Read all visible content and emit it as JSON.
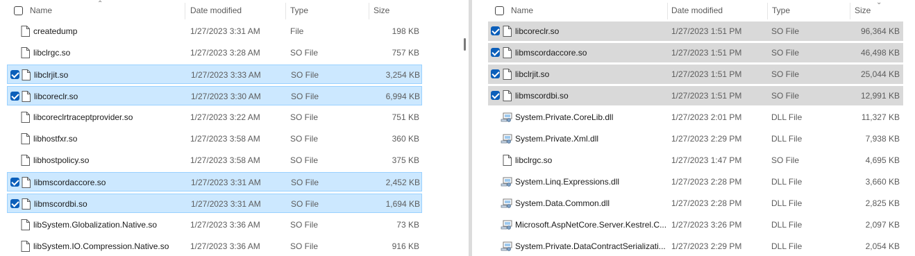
{
  "left": {
    "headers": {
      "name": "Name",
      "date": "Date modified",
      "type": "Type",
      "size": "Size"
    },
    "rows": [
      {
        "name": "createdump",
        "date": "1/27/2023 3:31 AM",
        "type": "File",
        "size": "198 KB",
        "selected": false,
        "icon": "file-icon"
      },
      {
        "name": "libclrgc.so",
        "date": "1/27/2023 3:28 AM",
        "type": "SO File",
        "size": "757 KB",
        "selected": false,
        "icon": "file-icon"
      },
      {
        "name": "libclrjit.so",
        "date": "1/27/2023 3:33 AM",
        "type": "SO File",
        "size": "3,254 KB",
        "selected": true,
        "icon": "file-icon"
      },
      {
        "name": "libcoreclr.so",
        "date": "1/27/2023 3:30 AM",
        "type": "SO File",
        "size": "6,994 KB",
        "selected": true,
        "icon": "file-icon"
      },
      {
        "name": "libcoreclrtraceptprovider.so",
        "date": "1/27/2023 3:22 AM",
        "type": "SO File",
        "size": "751 KB",
        "selected": false,
        "icon": "file-icon"
      },
      {
        "name": "libhostfxr.so",
        "date": "1/27/2023 3:58 AM",
        "type": "SO File",
        "size": "360 KB",
        "selected": false,
        "icon": "file-icon"
      },
      {
        "name": "libhostpolicy.so",
        "date": "1/27/2023 3:58 AM",
        "type": "SO File",
        "size": "375 KB",
        "selected": false,
        "icon": "file-icon"
      },
      {
        "name": "libmscordaccore.so",
        "date": "1/27/2023 3:31 AM",
        "type": "SO File",
        "size": "2,452 KB",
        "selected": true,
        "icon": "file-icon"
      },
      {
        "name": "libmscordbi.so",
        "date": "1/27/2023 3:31 AM",
        "type": "SO File",
        "size": "1,694 KB",
        "selected": true,
        "icon": "file-icon"
      },
      {
        "name": "libSystem.Globalization.Native.so",
        "date": "1/27/2023 3:36 AM",
        "type": "SO File",
        "size": "73 KB",
        "selected": false,
        "icon": "file-icon"
      },
      {
        "name": "libSystem.IO.Compression.Native.so",
        "date": "1/27/2023 3:36 AM",
        "type": "SO File",
        "size": "916 KB",
        "selected": false,
        "icon": "file-icon"
      }
    ]
  },
  "right": {
    "headers": {
      "name": "Name",
      "date": "Date modified",
      "type": "Type",
      "size": "Size"
    },
    "rows": [
      {
        "name": "libcoreclr.so",
        "date": "1/27/2023 1:51 PM",
        "type": "SO File",
        "size": "96,364 KB",
        "selected": true,
        "icon": "file-icon"
      },
      {
        "name": "libmscordaccore.so",
        "date": "1/27/2023 1:51 PM",
        "type": "SO File",
        "size": "46,498 KB",
        "selected": true,
        "icon": "file-icon"
      },
      {
        "name": "libclrjit.so",
        "date": "1/27/2023 1:51 PM",
        "type": "SO File",
        "size": "25,044 KB",
        "selected": true,
        "icon": "file-icon"
      },
      {
        "name": "libmscordbi.so",
        "date": "1/27/2023 1:51 PM",
        "type": "SO File",
        "size": "12,991 KB",
        "selected": true,
        "icon": "file-icon"
      },
      {
        "name": "System.Private.CoreLib.dll",
        "date": "1/27/2023 2:01 PM",
        "type": "DLL File",
        "size": "11,327 KB",
        "selected": false,
        "icon": "dll-icon"
      },
      {
        "name": "System.Private.Xml.dll",
        "date": "1/27/2023 2:29 PM",
        "type": "DLL File",
        "size": "7,938 KB",
        "selected": false,
        "icon": "dll-icon"
      },
      {
        "name": "libclrgc.so",
        "date": "1/27/2023 1:47 PM",
        "type": "SO File",
        "size": "4,695 KB",
        "selected": false,
        "icon": "file-icon"
      },
      {
        "name": "System.Linq.Expressions.dll",
        "date": "1/27/2023 2:28 PM",
        "type": "DLL File",
        "size": "3,660 KB",
        "selected": false,
        "icon": "dll-icon"
      },
      {
        "name": "System.Data.Common.dll",
        "date": "1/27/2023 2:28 PM",
        "type": "DLL File",
        "size": "2,825 KB",
        "selected": false,
        "icon": "dll-icon"
      },
      {
        "name": "Microsoft.AspNetCore.Server.Kestrel.C...",
        "date": "1/27/2023 3:26 PM",
        "type": "DLL File",
        "size": "2,097 KB",
        "selected": false,
        "icon": "dll-icon"
      },
      {
        "name": "System.Private.DataContractSerializati...",
        "date": "1/27/2023 2:29 PM",
        "type": "DLL File",
        "size": "2,054 KB",
        "selected": false,
        "icon": "dll-icon"
      }
    ]
  },
  "colors": {
    "selected_left": "#cce8ff",
    "selected_right": "#d9d9d9",
    "checkbox_accent": "#0c5fba"
  }
}
